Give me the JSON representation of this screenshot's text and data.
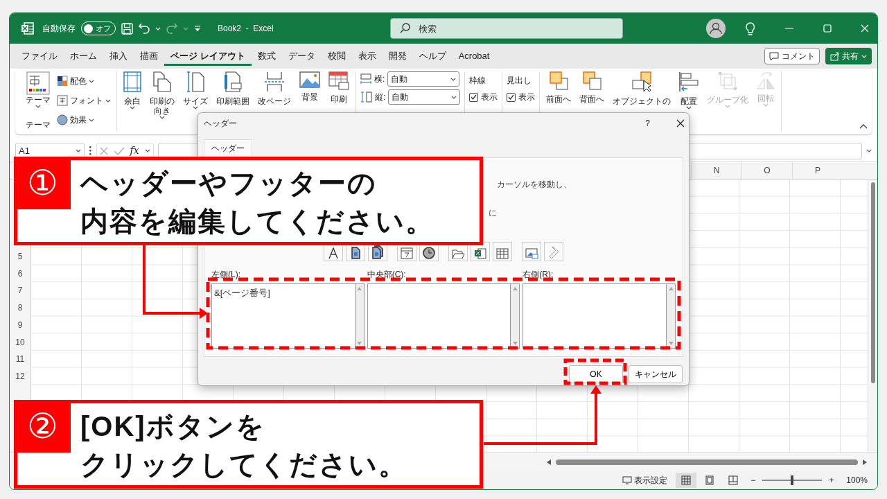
{
  "title_bar": {
    "autosave_label": "自動保存",
    "autosave_toggle": {
      "label": "オフ",
      "on": false
    },
    "title": "Book2  -  Excel",
    "search": {
      "placeholder": "検索"
    }
  },
  "ribbon_tabs": [
    {
      "label": "ファイル",
      "selected": false
    },
    {
      "label": "ホーム",
      "selected": false
    },
    {
      "label": "挿入",
      "selected": false
    },
    {
      "label": "描画",
      "selected": false
    },
    {
      "label": "ページ レイアウト",
      "selected": true
    },
    {
      "label": "数式",
      "selected": false
    },
    {
      "label": "データ",
      "selected": false
    },
    {
      "label": "校閲",
      "selected": false
    },
    {
      "label": "表示",
      "selected": false
    },
    {
      "label": "開発",
      "selected": false
    },
    {
      "label": "ヘルプ",
      "selected": false
    },
    {
      "label": "Acrobat",
      "selected": false
    }
  ],
  "ribbon_actions": [
    {
      "label": "コメント",
      "kind": "outline"
    },
    {
      "label": "共有",
      "kind": "primary"
    }
  ],
  "ribbon": {
    "theme_group": {
      "large": "テーマ",
      "items": [
        "配色",
        "フォント",
        "効果"
      ],
      "group_label": "テーマ"
    },
    "page_setup": [
      {
        "label_lines": [
          "余白"
        ],
        "dropdown": true
      },
      {
        "label_lines": [
          "印刷の",
          "向き"
        ],
        "dropdown": true
      },
      {
        "label_lines": [
          "サイズ"
        ],
        "dropdown": true
      },
      {
        "label_lines": [
          "印刷範囲"
        ],
        "dropdown": false
      },
      {
        "label_lines": [
          "改ページ"
        ],
        "dropdown": false
      },
      {
        "label_lines": [
          "背景"
        ],
        "dropdown": false
      },
      {
        "label_lines": [
          "印刷"
        ],
        "dropdown": false
      }
    ],
    "scale": [
      {
        "label": "横:",
        "value": "自動"
      },
      {
        "label": "縦:",
        "value": "自動"
      }
    ],
    "sheet_options": [
      {
        "title": "枠線",
        "checkboxes": [
          {
            "label": "表示",
            "checked": true
          }
        ]
      },
      {
        "title": "見出し",
        "checkboxes": [
          {
            "label": "表示",
            "checked": true
          }
        ]
      }
    ],
    "arrange": [
      {
        "label": "前面へ",
        "disabled": false,
        "dropdown": false
      },
      {
        "label": "背面へ",
        "disabled": false,
        "dropdown": false
      },
      {
        "label": "オブジェクトの",
        "disabled": false,
        "dropdown": false
      },
      {
        "label": "配置",
        "disabled": false,
        "dropdown": true
      },
      {
        "label": "グループ化",
        "disabled": true,
        "dropdown": true
      },
      {
        "label": "回転",
        "disabled": true,
        "dropdown": true
      }
    ]
  },
  "formula_bar": {
    "name_box": "A1",
    "function_label": "fx"
  },
  "sheet": {
    "columns": [
      "N",
      "O",
      "P"
    ],
    "rows": [
      "5",
      "6",
      "7",
      "8",
      "9",
      "10",
      "11",
      "12"
    ]
  },
  "dialog": {
    "title": "ヘッダー",
    "help": "?",
    "tab": "ヘッダー",
    "instructions": [
      "カーソルを移動し、",
      "に"
    ],
    "sections": [
      {
        "label": "左側(L):",
        "value": "&[ページ番号]"
      },
      {
        "label": "中央部(C):"
      },
      {
        "label": "右側(R):"
      }
    ],
    "buttons": [
      "OK",
      "キャンセル"
    ]
  },
  "status_bar": {
    "display_settings": "表示設定",
    "views": [
      {
        "selected": true
      },
      {
        "selected": false
      },
      {
        "selected": false
      }
    ],
    "zoom_out": "−",
    "zoom_in": "+",
    "zoom": {
      "level": 0.5,
      "reading": "100%"
    }
  },
  "callouts": [
    {
      "number": "①",
      "lines": [
        "ヘッダーやフッターの",
        "内容を編集してください。"
      ]
    },
    {
      "number": "②",
      "lines": [
        "[OK]ボタンを",
        "クリックしてください。"
      ]
    }
  ]
}
